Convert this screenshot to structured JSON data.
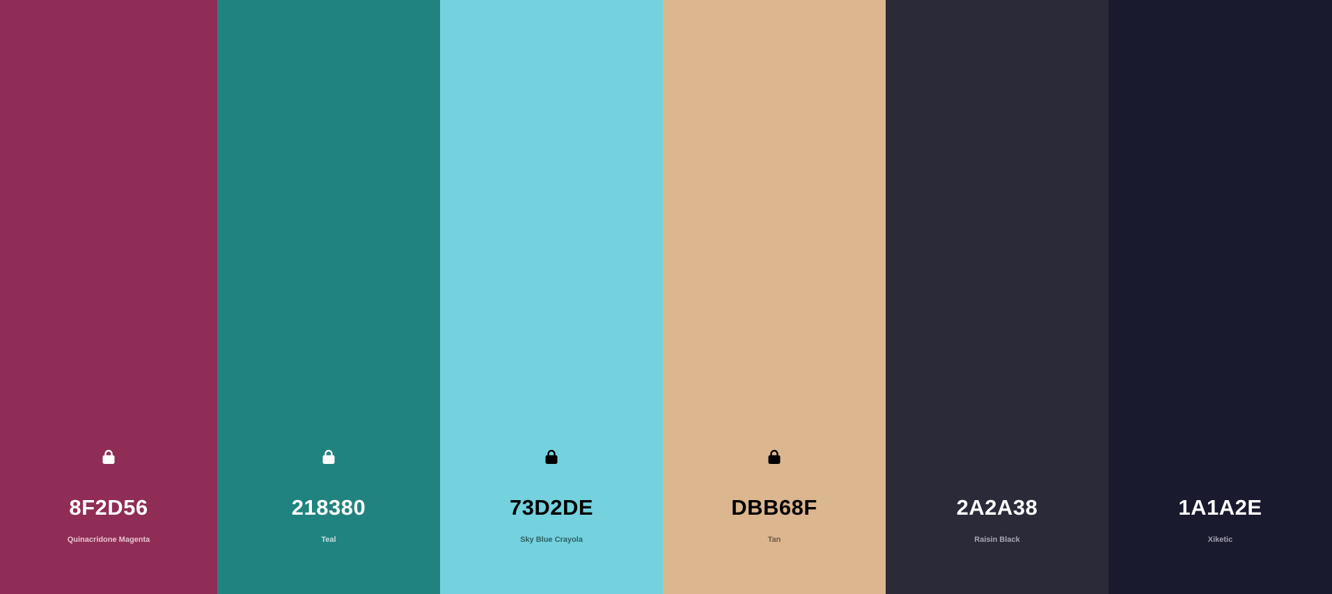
{
  "palette": {
    "swatches": [
      {
        "hex": "8F2D56",
        "name": "Quinacridone Magenta",
        "color": "#8F2D56",
        "text_color": "#FFFFFF",
        "name_color": "#E8C3D2",
        "locked": true,
        "lock_icon": "lock-icon"
      },
      {
        "hex": "218380",
        "name": "Teal",
        "color": "#218380",
        "text_color": "#FFFFFF",
        "name_color": "#C4E0DF",
        "locked": true,
        "lock_icon": "lock-icon"
      },
      {
        "hex": "73D2DE",
        "name": "Sky Blue Crayola",
        "color": "#73D2DE",
        "text_color": "#000000",
        "name_color": "#2F5F66",
        "locked": true,
        "lock_icon": "lock-icon"
      },
      {
        "hex": "DBB68F",
        "name": "Tan",
        "color": "#DBB68F",
        "text_color": "#000000",
        "name_color": "#6E5A45",
        "locked": true,
        "lock_icon": "lock-icon"
      },
      {
        "hex": "2A2A38",
        "name": "Raisin Black",
        "color": "#2A2A38",
        "text_color": "#FFFFFF",
        "name_color": "#A8A8B4",
        "locked": false
      },
      {
        "hex": "1A1A2E",
        "name": "Xiketic",
        "color": "#1A1A2E",
        "text_color": "#FFFFFF",
        "name_color": "#A0A0AE",
        "locked": false
      }
    ]
  }
}
